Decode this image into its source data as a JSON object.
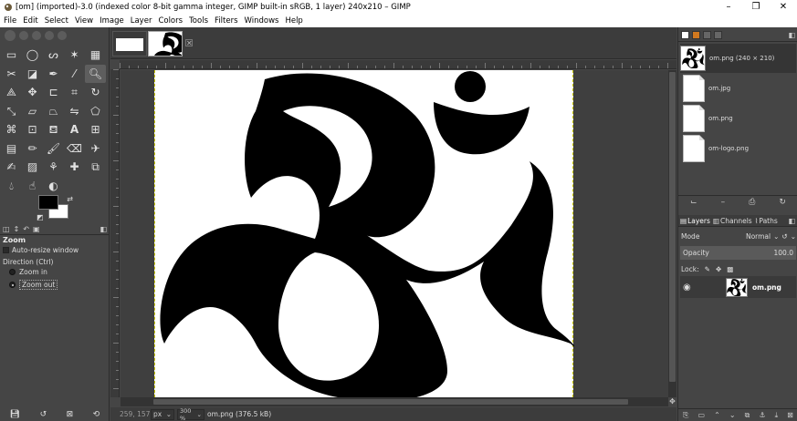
{
  "window": {
    "title": "[om] (imported)-3.0 (indexed color 8-bit gamma integer, GIMP built-in sRGB, 1 layer) 240x210 – GIMP",
    "minimize": "–",
    "maximize": "❐",
    "close": "✕"
  },
  "menu": [
    "File",
    "Edit",
    "Select",
    "View",
    "Image",
    "Layer",
    "Colors",
    "Tools",
    "Filters",
    "Windows",
    "Help"
  ],
  "tool_options": {
    "title": "Zoom",
    "auto_resize": "Auto-resize window",
    "direction_label": "Direction  (Ctrl)",
    "zoom_in": "Zoom in",
    "zoom_out": "Zoom out"
  },
  "statusbar": {
    "coords": "259, 157",
    "unit": "px",
    "zoom": "300 %",
    "message": "om.png (376.5 kB)"
  },
  "images_panel": {
    "items": [
      {
        "label": "om.png (240 × 210)",
        "selected": true
      },
      {
        "label": "om.jpg",
        "selected": false
      },
      {
        "label": "om.png",
        "selected": false
      },
      {
        "label": "om-logo.png",
        "selected": false
      }
    ]
  },
  "layers_panel": {
    "tab_layers": "Layers",
    "tab_channels": "Channels",
    "tab_paths": "Paths",
    "mode_label": "Mode",
    "mode_value": "Normal",
    "opacity_label": "Opacity",
    "opacity_value": "100.0",
    "lock_label": "Lock:",
    "layer_name": "om.png"
  },
  "colors": {
    "foreground": "#000000",
    "background": "#ffffff",
    "selection_outline": "#c8c800"
  }
}
